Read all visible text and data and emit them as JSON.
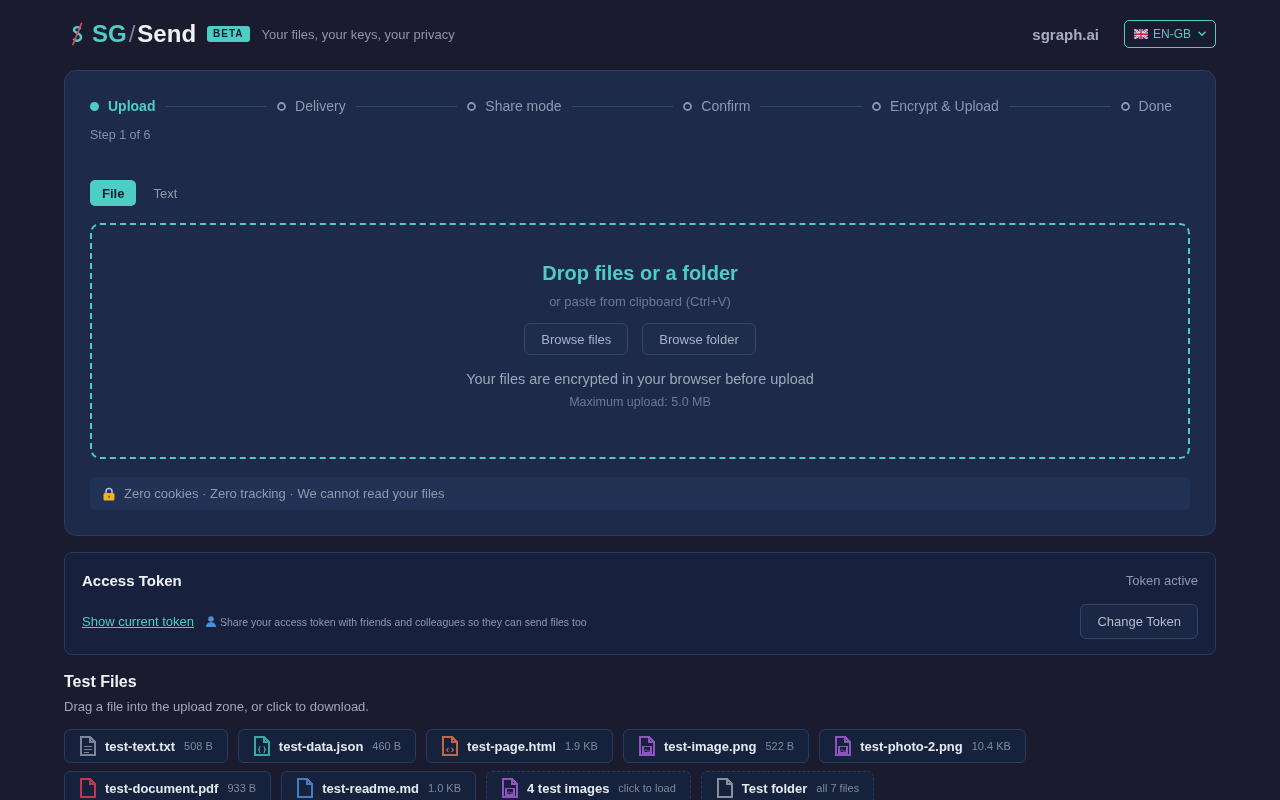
{
  "header": {
    "logo": {
      "left": "SG",
      "separator": "/",
      "right": "Send"
    },
    "badge": "BETA",
    "tagline": "Your files, your keys, your privacy",
    "site_link": "sgraph.ai",
    "language": "EN-GB"
  },
  "upload": {
    "steps": [
      {
        "label": "Upload",
        "selected": true
      },
      {
        "label": "Delivery",
        "selected": false
      },
      {
        "label": "Share mode",
        "selected": false
      },
      {
        "label": "Confirm",
        "selected": false
      },
      {
        "label": "Encrypt & Upload",
        "selected": false
      },
      {
        "label": "Done",
        "selected": false
      }
    ],
    "step_counter": "Step 1 of 6",
    "tabs": [
      {
        "label": "File",
        "selected": true
      },
      {
        "label": "Text",
        "selected": false
      }
    ],
    "drop_zone": {
      "title": "Drop files or a folder",
      "hint": "or paste from clipboard (Ctrl+V)",
      "buttons": [
        "Browse files",
        "Browse folder"
      ],
      "note": "Your files are encrypted in your browser before upload",
      "limit": "Maximum upload: 5.0 MB"
    },
    "privacy_note": "Zero cookies · Zero tracking · We cannot read your files"
  },
  "access_token": {
    "title": "Access Token",
    "status": "Token active",
    "link": "Show current token",
    "hint": "Share your access token with friends and colleagues so they can send files too",
    "button": "Change Token"
  },
  "test_files": {
    "title": "Test Files",
    "subtitle": "Drag a file into the upload zone, or click to download.",
    "items": [
      {
        "kind": "text",
        "color": "#7d8599",
        "name": "test-text.txt",
        "size": "508 B"
      },
      {
        "kind": "json",
        "color": "#3aa8a0",
        "name": "test-data.json",
        "size": "460 B"
      },
      {
        "kind": "html",
        "color": "#c0674a",
        "name": "test-page.html",
        "size": "1.9 KB"
      },
      {
        "kind": "image",
        "color": "#8e55c0",
        "name": "test-image.png",
        "size": "522 B"
      },
      {
        "kind": "image",
        "color": "#8e55c0",
        "name": "test-photo-2.png",
        "size": "10.4 KB"
      },
      {
        "kind": "pdf",
        "color": "#c0384f",
        "name": "test-document.pdf",
        "size": "933 B"
      },
      {
        "kind": "markdown",
        "color": "#4a7ac0",
        "name": "test-readme.md",
        "size": "1.0 KB"
      },
      {
        "kind": "gallery",
        "color": "#8e55c0",
        "name": "4 test images",
        "size": "click to load"
      },
      {
        "kind": "folder",
        "color": "#8a8f9e",
        "name": "Test folder",
        "size": "all 7 files"
      }
    ]
  }
}
